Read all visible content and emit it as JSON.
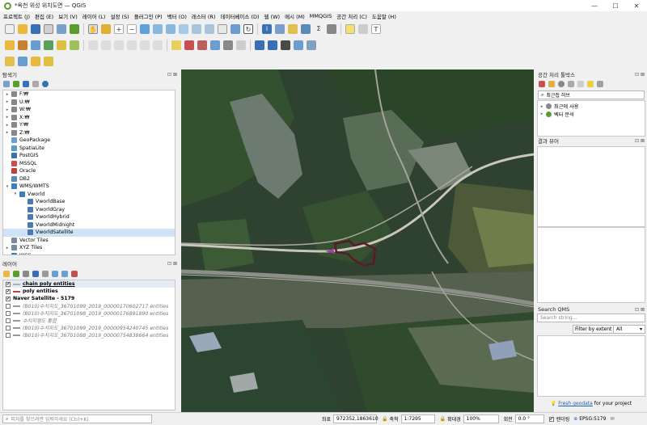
{
  "window": {
    "title": "*옥천 위성 위치도면 — QGIS",
    "minimize": "—",
    "maximize": "☐",
    "close": "✕"
  },
  "menu": [
    "프로젝트 (J)",
    "편집 (E)",
    "보기 (V)",
    "레이어 (L)",
    "설정 (S)",
    "플러그인 (P)",
    "벡터 (O)",
    "래스터 (R)",
    "데이터베이스 (D)",
    "웹 (W)",
    "메시 (M)",
    "MMQGIS",
    "공간 처리 (C)",
    "도움말 (H)"
  ],
  "browser": {
    "title": "탐색기",
    "items": [
      {
        "label": "F:₩",
        "indent": 0,
        "exp": "▸",
        "icon": "drive"
      },
      {
        "label": "U:₩",
        "indent": 0,
        "exp": "▸",
        "icon": "drive"
      },
      {
        "label": "W:₩",
        "indent": 0,
        "exp": "▸",
        "icon": "drive"
      },
      {
        "label": "X:₩",
        "indent": 0,
        "exp": "▸",
        "icon": "drive"
      },
      {
        "label": "Y:₩",
        "indent": 0,
        "exp": "▸",
        "icon": "drive"
      },
      {
        "label": "Z:₩",
        "indent": 0,
        "exp": "▸",
        "icon": "drive"
      },
      {
        "label": "GeoPackage",
        "indent": 0,
        "exp": "",
        "icon": "gpkg"
      },
      {
        "label": "SpatiaLite",
        "indent": 0,
        "exp": "",
        "icon": "spatialite"
      },
      {
        "label": "PostGIS",
        "indent": 0,
        "exp": "",
        "icon": "postgis"
      },
      {
        "label": "MSSQL",
        "indent": 0,
        "exp": "",
        "icon": "mssql"
      },
      {
        "label": "Oracle",
        "indent": 0,
        "exp": "",
        "icon": "oracle"
      },
      {
        "label": "DB2",
        "indent": 0,
        "exp": "",
        "icon": "db2"
      },
      {
        "label": "WMS/WMTS",
        "indent": 0,
        "exp": "▾",
        "icon": "wms"
      },
      {
        "label": "Vworld",
        "indent": 1,
        "exp": "▾",
        "icon": "wms"
      },
      {
        "label": "VworldBase",
        "indent": 2,
        "exp": "",
        "icon": "raster"
      },
      {
        "label": "VworldGray",
        "indent": 2,
        "exp": "",
        "icon": "raster"
      },
      {
        "label": "VworldHybrid",
        "indent": 2,
        "exp": "",
        "icon": "raster"
      },
      {
        "label": "VworldMidnight",
        "indent": 2,
        "exp": "",
        "icon": "raster"
      },
      {
        "label": "VworldSatellite",
        "indent": 2,
        "exp": "",
        "icon": "raster"
      },
      {
        "label": "Vector Tiles",
        "indent": 0,
        "exp": "",
        "icon": "grid"
      },
      {
        "label": "XYZ Tiles",
        "indent": 0,
        "exp": "▸",
        "icon": "grid"
      },
      {
        "label": "WCS",
        "indent": 0,
        "exp": "",
        "icon": "wms"
      }
    ]
  },
  "layers": {
    "title": "레이어",
    "items": [
      {
        "label": "chain poly entities",
        "checked": true,
        "bold": true,
        "underline": true,
        "italic": false,
        "sym": "#b0b0b0"
      },
      {
        "label": "poly entities",
        "checked": true,
        "bold": true,
        "underline": false,
        "italic": false,
        "sym": "#c04040"
      },
      {
        "label": "Naver Satellite - 5179",
        "checked": true,
        "bold": true,
        "underline": false,
        "italic": false,
        "sym": ""
      },
      {
        "label": "(B010)수치지도_36701099_2019_00000170602717 entities",
        "checked": false,
        "bold": false,
        "underline": false,
        "italic": true,
        "sym": "#999"
      },
      {
        "label": "(B010)수치지도_36701098_2019_00000176891890 entities",
        "checked": false,
        "bold": false,
        "underline": false,
        "italic": true,
        "sym": "#999"
      },
      {
        "label": "수치지형도 통합",
        "checked": false,
        "bold": false,
        "underline": false,
        "italic": true,
        "sym": "#999"
      },
      {
        "label": "(B010)수치지도_36701099_2019_00000954240745 entities",
        "checked": false,
        "bold": false,
        "underline": false,
        "italic": true,
        "sym": "#999"
      },
      {
        "label": "(B010)수치지도_36701088_2019_00000754838664 entities",
        "checked": false,
        "bold": false,
        "underline": false,
        "italic": true,
        "sym": "#999"
      }
    ]
  },
  "processing": {
    "title": "공간 처리 툴박스",
    "search_placeholder": "최근접 허브",
    "items": [
      "최근에 사용",
      "벡터 분석"
    ]
  },
  "results": {
    "title": "결과 뷰어"
  },
  "qms": {
    "title": "Search QMS",
    "placeholder": "Search string...",
    "filter_label": "Filter by extent",
    "filter_value": "All",
    "footer_link": "Fresh geodata",
    "footer_text": " for your project"
  },
  "search_bar": {
    "placeholder": "피처를 찾으려면 입력하세요 (Ctrl+K)"
  },
  "status": {
    "coord_label": "좌표",
    "coord": "972352,1863610",
    "scale_label": "축척",
    "scale": "1:7295",
    "magnifier_label": "확대경",
    "magnifier": "100%",
    "rotation_label": "회전",
    "rotation": "0.0 °",
    "render_label": "렌더링",
    "crs": "EPSG:5179"
  }
}
